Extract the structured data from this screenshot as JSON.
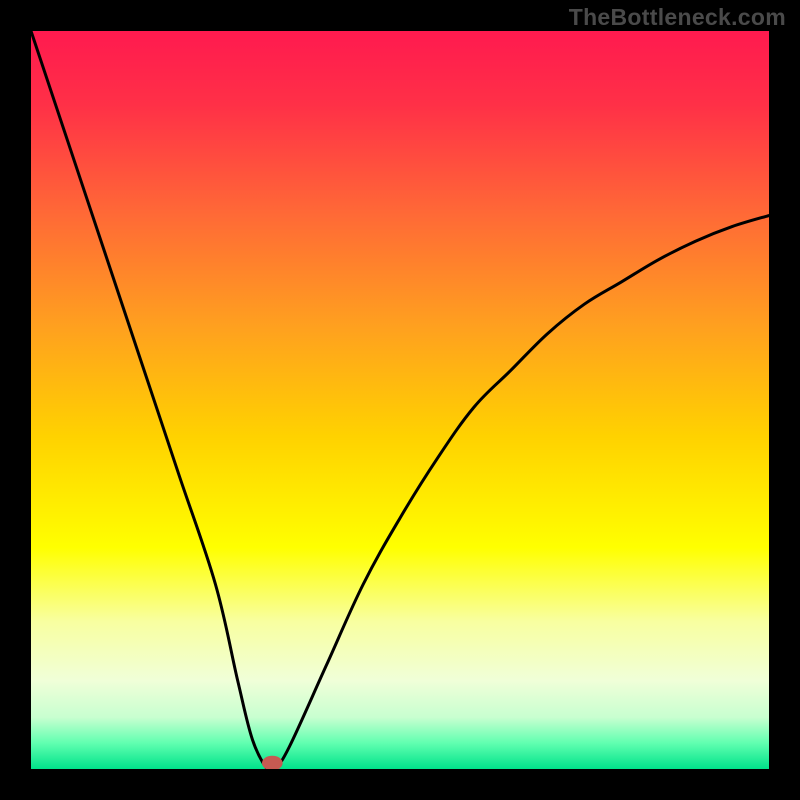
{
  "watermark": "TheBottleneck.com",
  "chart_data": {
    "type": "line",
    "title": "",
    "xlabel": "",
    "ylabel": "",
    "xlim": [
      0,
      100
    ],
    "ylim": [
      0,
      100
    ],
    "background_gradient": {
      "stops": [
        {
          "offset": 0,
          "color": "#ff1a4f"
        },
        {
          "offset": 0.1,
          "color": "#ff3047"
        },
        {
          "offset": 0.25,
          "color": "#ff6a36"
        },
        {
          "offset": 0.4,
          "color": "#ffa01f"
        },
        {
          "offset": 0.55,
          "color": "#ffd200"
        },
        {
          "offset": 0.7,
          "color": "#ffff00"
        },
        {
          "offset": 0.8,
          "color": "#f8ffa0"
        },
        {
          "offset": 0.88,
          "color": "#f0ffd8"
        },
        {
          "offset": 0.93,
          "color": "#c8ffd0"
        },
        {
          "offset": 0.965,
          "color": "#60ffb0"
        },
        {
          "offset": 1.0,
          "color": "#00e28a"
        }
      ]
    },
    "series": [
      {
        "name": "bottleneck-curve",
        "x": [
          0,
          5,
          10,
          15,
          20,
          25,
          28,
          30,
          32,
          33,
          35,
          40,
          45,
          50,
          55,
          60,
          65,
          70,
          75,
          80,
          85,
          90,
          95,
          100
        ],
        "y": [
          100,
          85,
          70,
          55,
          40,
          25,
          12,
          4,
          0,
          0,
          3,
          14,
          25,
          34,
          42,
          49,
          54,
          59,
          63,
          66,
          69,
          71.5,
          73.5,
          75
        ]
      }
    ],
    "marker": {
      "name": "optimal-point",
      "x": 32.7,
      "y": 0.8,
      "rx": 1.4,
      "ry": 1.0,
      "color": "#c65a52"
    }
  }
}
